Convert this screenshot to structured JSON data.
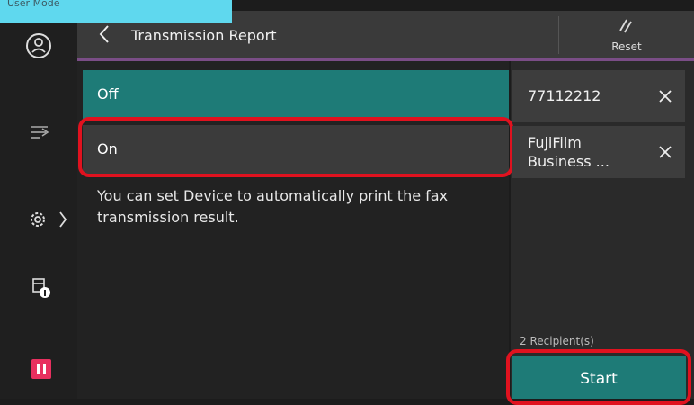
{
  "mode_label": "User Mode",
  "header": {
    "title": "Transmission Report",
    "reset_label": "Reset"
  },
  "options": [
    {
      "label": "Off",
      "selected": true
    },
    {
      "label": "On",
      "selected": false
    }
  ],
  "description": "You can set Device to automatically print the fax transmission result.",
  "recipients": [
    {
      "lines": [
        "77112212"
      ]
    },
    {
      "lines": [
        "FujiFilm",
        "Business ..."
      ]
    }
  ],
  "recipient_count": "2 Recipient(s)",
  "start_label": "Start",
  "colors": {
    "accent_teal": "#1e7b77",
    "highlight_red": "#e0121f",
    "mode_tab": "#5fd8ee",
    "pause_icon": "#e8305f"
  },
  "icons": [
    "user-icon",
    "back-icon",
    "reset-icon",
    "transfer-icon",
    "gear-icon",
    "device-info-icon",
    "pause-icon",
    "close-icon"
  ]
}
